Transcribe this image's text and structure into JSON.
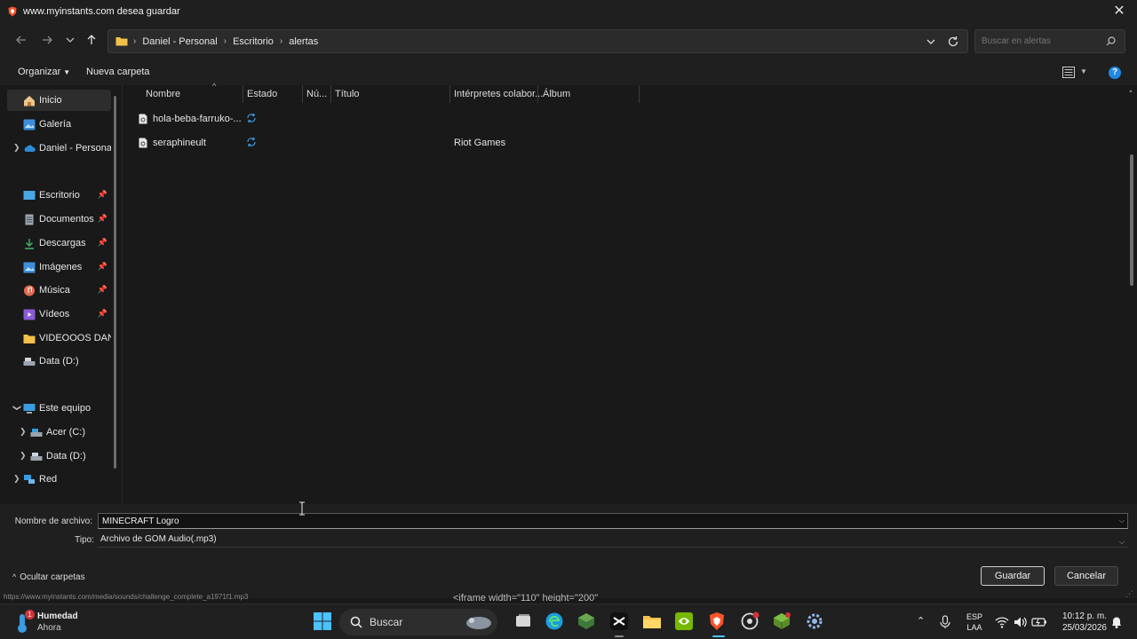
{
  "titlebar": {
    "title": "www.myinstants.com desea guardar",
    "close_icon": "close-icon"
  },
  "address": {
    "crumbs": [
      "Daniel - Personal",
      "Escritorio",
      "alertas"
    ],
    "search_placeholder": "Buscar en alertas"
  },
  "commands": {
    "organize": "Organizar",
    "new_folder": "Nueva carpeta"
  },
  "nav": {
    "items": [
      {
        "label": "Inicio",
        "icon": "home-icon"
      },
      {
        "label": "Galería",
        "icon": "gallery-icon"
      },
      {
        "label": "Daniel - Personal",
        "icon": "onedrive-icon"
      },
      {
        "label": "Escritorio",
        "icon": "desktop-icon"
      },
      {
        "label": "Documentos",
        "icon": "documents-icon"
      },
      {
        "label": "Descargas",
        "icon": "downloads-icon"
      },
      {
        "label": "Imágenes",
        "icon": "pictures-icon"
      },
      {
        "label": "Música",
        "icon": "music-icon"
      },
      {
        "label": "Vídeos",
        "icon": "videos-icon"
      },
      {
        "label": "VIDEOOOS DANIEL",
        "icon": "folder-icon"
      },
      {
        "label": "Data (D:)",
        "icon": "drive-icon"
      },
      {
        "label": "Este equipo",
        "icon": "pc-icon"
      },
      {
        "label": "Acer (C:)",
        "icon": "drive-icon"
      },
      {
        "label": "Data (D:)",
        "icon": "drive-icon"
      },
      {
        "label": "Red",
        "icon": "network-icon"
      }
    ]
  },
  "columns": [
    "Nombre",
    "Estado",
    "Nú...",
    "Título",
    "Intérpretes colabor...",
    "Álbum"
  ],
  "files": [
    {
      "name": "hola-beba-farruko-...",
      "artist": ""
    },
    {
      "name": "seraphineult",
      "artist": "Riot Games"
    }
  ],
  "form": {
    "filename_label": "Nombre de archivo:",
    "filename_value": "MINECRAFT Logro",
    "type_label": "Tipo:",
    "type_value": "Archivo de GOM Audio(.mp3)",
    "hide_folders": "Ocultar carpetas",
    "save": "Guardar",
    "cancel": "Cancelar"
  },
  "status_url": "https://www.myinstants.com/media/sounds/challenge_complete_a1971f1.mp3",
  "background_text": "<iframe width=\"110\" height=\"200\"",
  "taskbar": {
    "weather_title": "Humedad",
    "weather_sub": "Ahora",
    "weather_badge": "1",
    "search_label": "Buscar",
    "lang_1": "ESP",
    "lang_2": "LAA",
    "time": "10:12 p. m.",
    "date": "25/03/2026"
  },
  "colors": {
    "accent": "#1e88e5",
    "background": "#191919",
    "chrome": "#1f1f1f"
  }
}
